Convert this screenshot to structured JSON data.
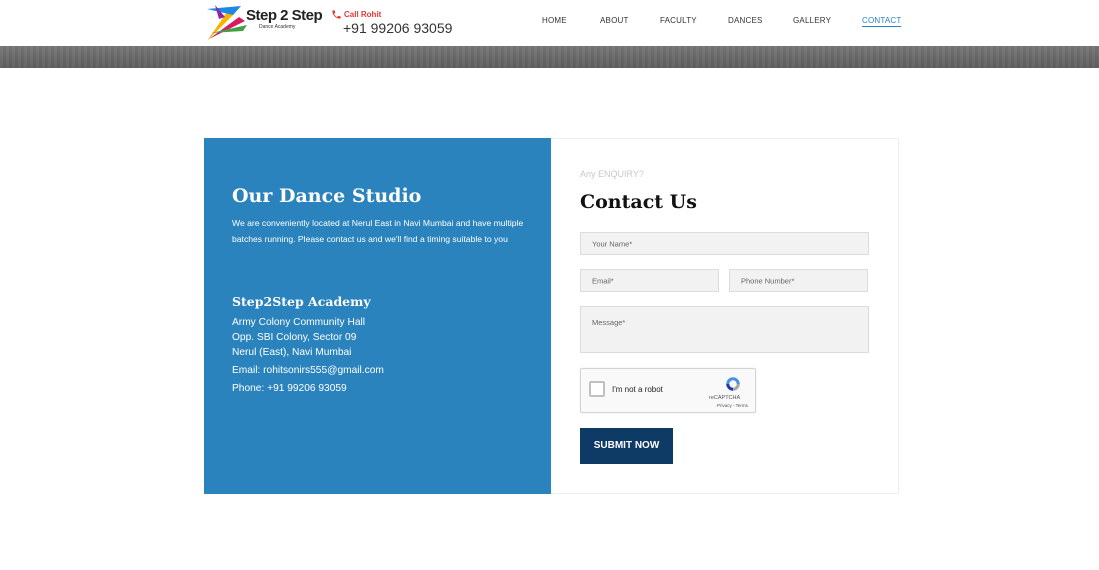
{
  "brand": {
    "name": "Step 2 Step",
    "tagline": "Dance Academy",
    "colors": {
      "primary_blue": "#2b83bd",
      "navy": "#0e3a66",
      "accent_red": "#e53935"
    }
  },
  "header": {
    "call_label": "Call Rohit",
    "call_number": "+91 99206 93059",
    "call_icon": "phone-icon",
    "nav": [
      "HOME",
      "ABOUT",
      "FACULTY",
      "DANCES",
      "GALLERY",
      "CONTACT"
    ],
    "active_nav": "CONTACT"
  },
  "studio": {
    "title": "Our Dance Studio",
    "description": "We are conveniently located at Nerul East in Navi Mumbai and have multiple batches running. Please contact us and we'll find a timing suitable to you",
    "academy_name": "Step2Step Academy",
    "address": [
      "Army Colony Community Hall",
      "Opp. SBI Colony, Sector 09",
      "Nerul (East), Navi Mumbai"
    ],
    "email": "Email: rohitsonirs555@gmail.com",
    "phone": "Phone: +91 99206 93059"
  },
  "contact_form": {
    "kicker": "Any ENQUIRY?",
    "title": "Contact Us",
    "name_placeholder": "Your Name*",
    "email_placeholder": "Email*",
    "phone_placeholder": "Phone Number*",
    "message_placeholder": "Message*",
    "captcha": {
      "label": "I'm not a robot",
      "brand": "reCAPTCHA",
      "links": "Privacy - Terms",
      "icon": "recaptcha-icon"
    },
    "submit_label": "SUBMIT NOW"
  }
}
